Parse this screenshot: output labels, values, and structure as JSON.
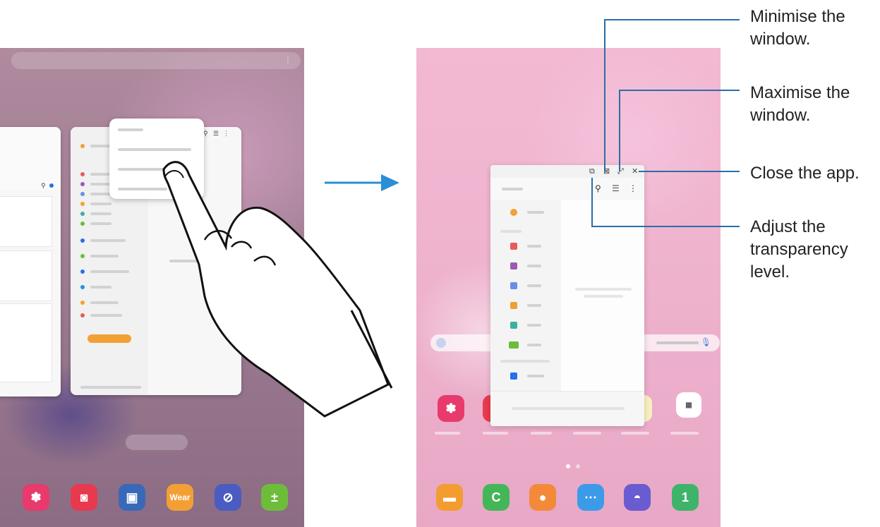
{
  "callouts": {
    "minimise": "Minimise the window.",
    "maximise": "Maximise the window.",
    "close": "Close the app.",
    "transparency": "Adjust the transparency level."
  },
  "left_dock_icons": [
    {
      "name": "gallery-icon",
      "color": "#e83a6c",
      "glyph": "✽"
    },
    {
      "name": "camera-icon",
      "color": "#e83a4e",
      "glyph": "◙"
    },
    {
      "name": "secure-folder-icon",
      "color": "#3869b8",
      "glyph": "▣"
    },
    {
      "name": "wear-icon",
      "color": "#f2a035",
      "glyph": "Wear"
    },
    {
      "name": "compass-icon",
      "color": "#4a5cc2",
      "glyph": "⊘"
    },
    {
      "name": "calculator-icon",
      "color": "#6dbd3a",
      "glyph": "±"
    }
  ],
  "right_dock_icons": [
    {
      "name": "my-files-icon",
      "color": "#f39c30",
      "glyph": "▬"
    },
    {
      "name": "phone-icon",
      "color": "#43b757",
      "glyph": "C"
    },
    {
      "name": "contacts-icon",
      "color": "#f38a3a",
      "glyph": "●"
    },
    {
      "name": "messages-icon",
      "color": "#3c9be8",
      "glyph": "⋯"
    },
    {
      "name": "internet-icon",
      "color": "#6a5bd0",
      "glyph": "◓"
    },
    {
      "name": "calendar-icon",
      "color": "#3db46a",
      "glyph": "1"
    }
  ],
  "colors": {
    "accent": "#2a8fd6",
    "callout_line": "#2a6ea8"
  }
}
